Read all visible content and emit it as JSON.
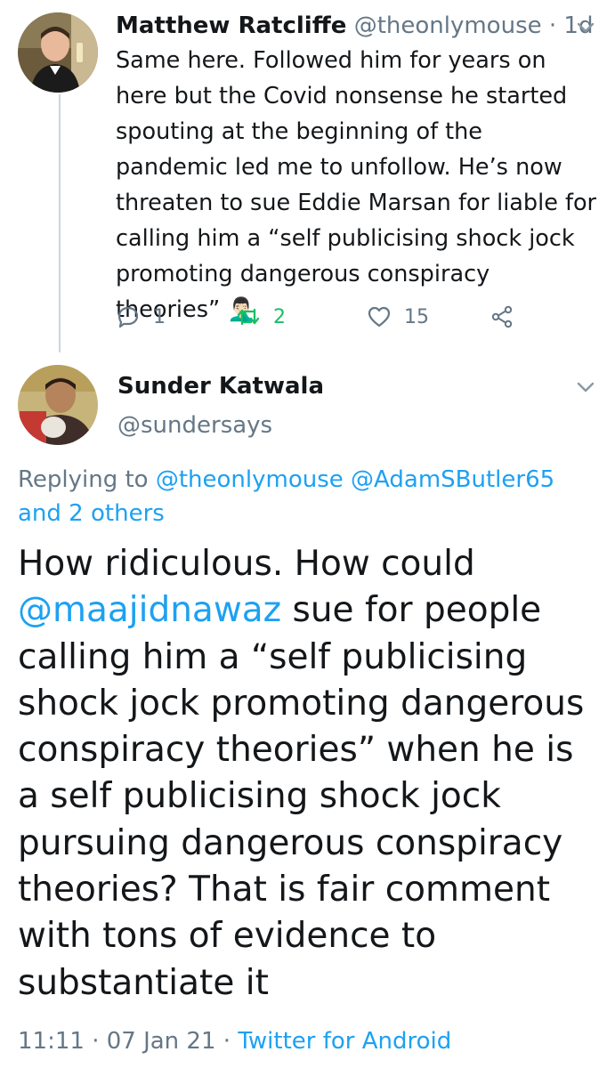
{
  "reply_tweet": {
    "display_name": "Matthew Ratcliffe",
    "handle": "@theonlymouse",
    "separator": "·",
    "age": "1d",
    "text": "Same here. Followed him for years on here but the Covid nonsense he started spouting at the beginning of the pandemic led me to unfollow. He’s now threaten to sue Eddie Marsan for liable for calling him a “self publicising shock jock promoting dangerous conspiracy theories”",
    "emoji": "🤦🏻‍♂️",
    "reply_count": "1",
    "retweet_count": "2",
    "like_count": "15",
    "retweet_color": "#17bf63"
  },
  "main_tweet": {
    "display_name": "Sunder Katwala",
    "handle": "@sundersays",
    "replying_prefix": "Replying to",
    "replying_mention_1": "@theonlymouse",
    "replying_mention_2": "@AdamSButler65",
    "replying_and": "and 2 others",
    "text_part_1": "How ridiculous. How could",
    "mention": "@maajidnawaz",
    "text_part_2": "sue for people calling him a “self publicising shock jock promoting dangerous conspiracy theories” when he is a self publicising shock jock pursuing dangerous conspiracy theories? That is fair comment with tons of evidence to substantiate it",
    "time": "11:11",
    "date": "07 Jan 21",
    "client": "Twitter for Android"
  },
  "icons": {
    "reply": "reply-icon",
    "retweet": "retweet-icon",
    "like": "heart-icon",
    "share": "share-icon",
    "menu": "chevron-down-icon"
  },
  "colors": {
    "link": "#1da1f2",
    "secondary_text": "#657786",
    "primary_text": "#14171a",
    "thread_line": "#ccd6dd"
  }
}
